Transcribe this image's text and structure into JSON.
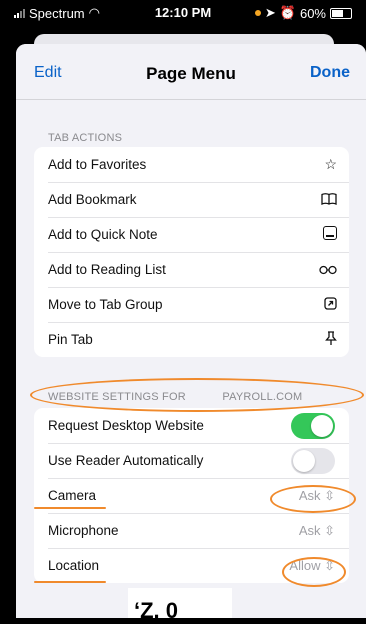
{
  "status_bar": {
    "carrier": "Spectrum",
    "time": "12:10 PM",
    "battery": "60%"
  },
  "nav": {
    "edit": "Edit",
    "title": "Page Menu",
    "done": "Done"
  },
  "tab_actions": {
    "header": "TAB ACTIONS",
    "items": [
      {
        "label": "Add to Favorites",
        "icon": "star-icon"
      },
      {
        "label": "Add Bookmark",
        "icon": "book-icon"
      },
      {
        "label": "Add to Quick Note",
        "icon": "quick-note-icon"
      },
      {
        "label": "Add to Reading List",
        "icon": "glasses-icon"
      },
      {
        "label": "Move to Tab Group",
        "icon": "move-to-group-icon"
      },
      {
        "label": "Pin Tab",
        "icon": "pin-icon"
      }
    ]
  },
  "website_settings": {
    "header": "WEBSITE SETTINGS FOR",
    "domain": "PAYROLL.COM",
    "rows": [
      {
        "label": "Request Desktop Website",
        "toggle": "on"
      },
      {
        "label": "Use Reader Automatically",
        "toggle": "off"
      },
      {
        "label": "Camera",
        "value": "Ask"
      },
      {
        "label": "Microphone",
        "value": "Ask"
      },
      {
        "label": "Location",
        "value": "Allow"
      }
    ]
  },
  "colors": {
    "accent": "#0a62c8",
    "toggle_on": "#34c759",
    "annotation": "#f08a2c"
  }
}
